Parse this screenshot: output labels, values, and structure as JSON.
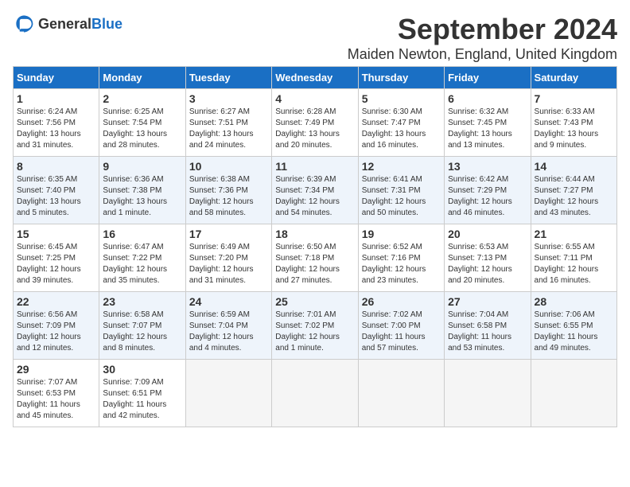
{
  "logo": {
    "general": "General",
    "blue": "Blue"
  },
  "title": "September 2024",
  "subtitle": "Maiden Newton, England, United Kingdom",
  "weekdays": [
    "Sunday",
    "Monday",
    "Tuesday",
    "Wednesday",
    "Thursday",
    "Friday",
    "Saturday"
  ],
  "weeks": [
    [
      {
        "day": "1",
        "lines": [
          "Sunrise: 6:24 AM",
          "Sunset: 7:56 PM",
          "Daylight: 13 hours",
          "and 31 minutes."
        ]
      },
      {
        "day": "2",
        "lines": [
          "Sunrise: 6:25 AM",
          "Sunset: 7:54 PM",
          "Daylight: 13 hours",
          "and 28 minutes."
        ]
      },
      {
        "day": "3",
        "lines": [
          "Sunrise: 6:27 AM",
          "Sunset: 7:51 PM",
          "Daylight: 13 hours",
          "and 24 minutes."
        ]
      },
      {
        "day": "4",
        "lines": [
          "Sunrise: 6:28 AM",
          "Sunset: 7:49 PM",
          "Daylight: 13 hours",
          "and 20 minutes."
        ]
      },
      {
        "day": "5",
        "lines": [
          "Sunrise: 6:30 AM",
          "Sunset: 7:47 PM",
          "Daylight: 13 hours",
          "and 16 minutes."
        ]
      },
      {
        "day": "6",
        "lines": [
          "Sunrise: 6:32 AM",
          "Sunset: 7:45 PM",
          "Daylight: 13 hours",
          "and 13 minutes."
        ]
      },
      {
        "day": "7",
        "lines": [
          "Sunrise: 6:33 AM",
          "Sunset: 7:43 PM",
          "Daylight: 13 hours",
          "and 9 minutes."
        ]
      }
    ],
    [
      {
        "day": "8",
        "lines": [
          "Sunrise: 6:35 AM",
          "Sunset: 7:40 PM",
          "Daylight: 13 hours",
          "and 5 minutes."
        ]
      },
      {
        "day": "9",
        "lines": [
          "Sunrise: 6:36 AM",
          "Sunset: 7:38 PM",
          "Daylight: 13 hours",
          "and 1 minute."
        ]
      },
      {
        "day": "10",
        "lines": [
          "Sunrise: 6:38 AM",
          "Sunset: 7:36 PM",
          "Daylight: 12 hours",
          "and 58 minutes."
        ]
      },
      {
        "day": "11",
        "lines": [
          "Sunrise: 6:39 AM",
          "Sunset: 7:34 PM",
          "Daylight: 12 hours",
          "and 54 minutes."
        ]
      },
      {
        "day": "12",
        "lines": [
          "Sunrise: 6:41 AM",
          "Sunset: 7:31 PM",
          "Daylight: 12 hours",
          "and 50 minutes."
        ]
      },
      {
        "day": "13",
        "lines": [
          "Sunrise: 6:42 AM",
          "Sunset: 7:29 PM",
          "Daylight: 12 hours",
          "and 46 minutes."
        ]
      },
      {
        "day": "14",
        "lines": [
          "Sunrise: 6:44 AM",
          "Sunset: 7:27 PM",
          "Daylight: 12 hours",
          "and 43 minutes."
        ]
      }
    ],
    [
      {
        "day": "15",
        "lines": [
          "Sunrise: 6:45 AM",
          "Sunset: 7:25 PM",
          "Daylight: 12 hours",
          "and 39 minutes."
        ]
      },
      {
        "day": "16",
        "lines": [
          "Sunrise: 6:47 AM",
          "Sunset: 7:22 PM",
          "Daylight: 12 hours",
          "and 35 minutes."
        ]
      },
      {
        "day": "17",
        "lines": [
          "Sunrise: 6:49 AM",
          "Sunset: 7:20 PM",
          "Daylight: 12 hours",
          "and 31 minutes."
        ]
      },
      {
        "day": "18",
        "lines": [
          "Sunrise: 6:50 AM",
          "Sunset: 7:18 PM",
          "Daylight: 12 hours",
          "and 27 minutes."
        ]
      },
      {
        "day": "19",
        "lines": [
          "Sunrise: 6:52 AM",
          "Sunset: 7:16 PM",
          "Daylight: 12 hours",
          "and 23 minutes."
        ]
      },
      {
        "day": "20",
        "lines": [
          "Sunrise: 6:53 AM",
          "Sunset: 7:13 PM",
          "Daylight: 12 hours",
          "and 20 minutes."
        ]
      },
      {
        "day": "21",
        "lines": [
          "Sunrise: 6:55 AM",
          "Sunset: 7:11 PM",
          "Daylight: 12 hours",
          "and 16 minutes."
        ]
      }
    ],
    [
      {
        "day": "22",
        "lines": [
          "Sunrise: 6:56 AM",
          "Sunset: 7:09 PM",
          "Daylight: 12 hours",
          "and 12 minutes."
        ]
      },
      {
        "day": "23",
        "lines": [
          "Sunrise: 6:58 AM",
          "Sunset: 7:07 PM",
          "Daylight: 12 hours",
          "and 8 minutes."
        ]
      },
      {
        "day": "24",
        "lines": [
          "Sunrise: 6:59 AM",
          "Sunset: 7:04 PM",
          "Daylight: 12 hours",
          "and 4 minutes."
        ]
      },
      {
        "day": "25",
        "lines": [
          "Sunrise: 7:01 AM",
          "Sunset: 7:02 PM",
          "Daylight: 12 hours",
          "and 1 minute."
        ]
      },
      {
        "day": "26",
        "lines": [
          "Sunrise: 7:02 AM",
          "Sunset: 7:00 PM",
          "Daylight: 11 hours",
          "and 57 minutes."
        ]
      },
      {
        "day": "27",
        "lines": [
          "Sunrise: 7:04 AM",
          "Sunset: 6:58 PM",
          "Daylight: 11 hours",
          "and 53 minutes."
        ]
      },
      {
        "day": "28",
        "lines": [
          "Sunrise: 7:06 AM",
          "Sunset: 6:55 PM",
          "Daylight: 11 hours",
          "and 49 minutes."
        ]
      }
    ],
    [
      {
        "day": "29",
        "lines": [
          "Sunrise: 7:07 AM",
          "Sunset: 6:53 PM",
          "Daylight: 11 hours",
          "and 45 minutes."
        ]
      },
      {
        "day": "30",
        "lines": [
          "Sunrise: 7:09 AM",
          "Sunset: 6:51 PM",
          "Daylight: 11 hours",
          "and 42 minutes."
        ]
      },
      {
        "day": "",
        "lines": []
      },
      {
        "day": "",
        "lines": []
      },
      {
        "day": "",
        "lines": []
      },
      {
        "day": "",
        "lines": []
      },
      {
        "day": "",
        "lines": []
      }
    ]
  ]
}
